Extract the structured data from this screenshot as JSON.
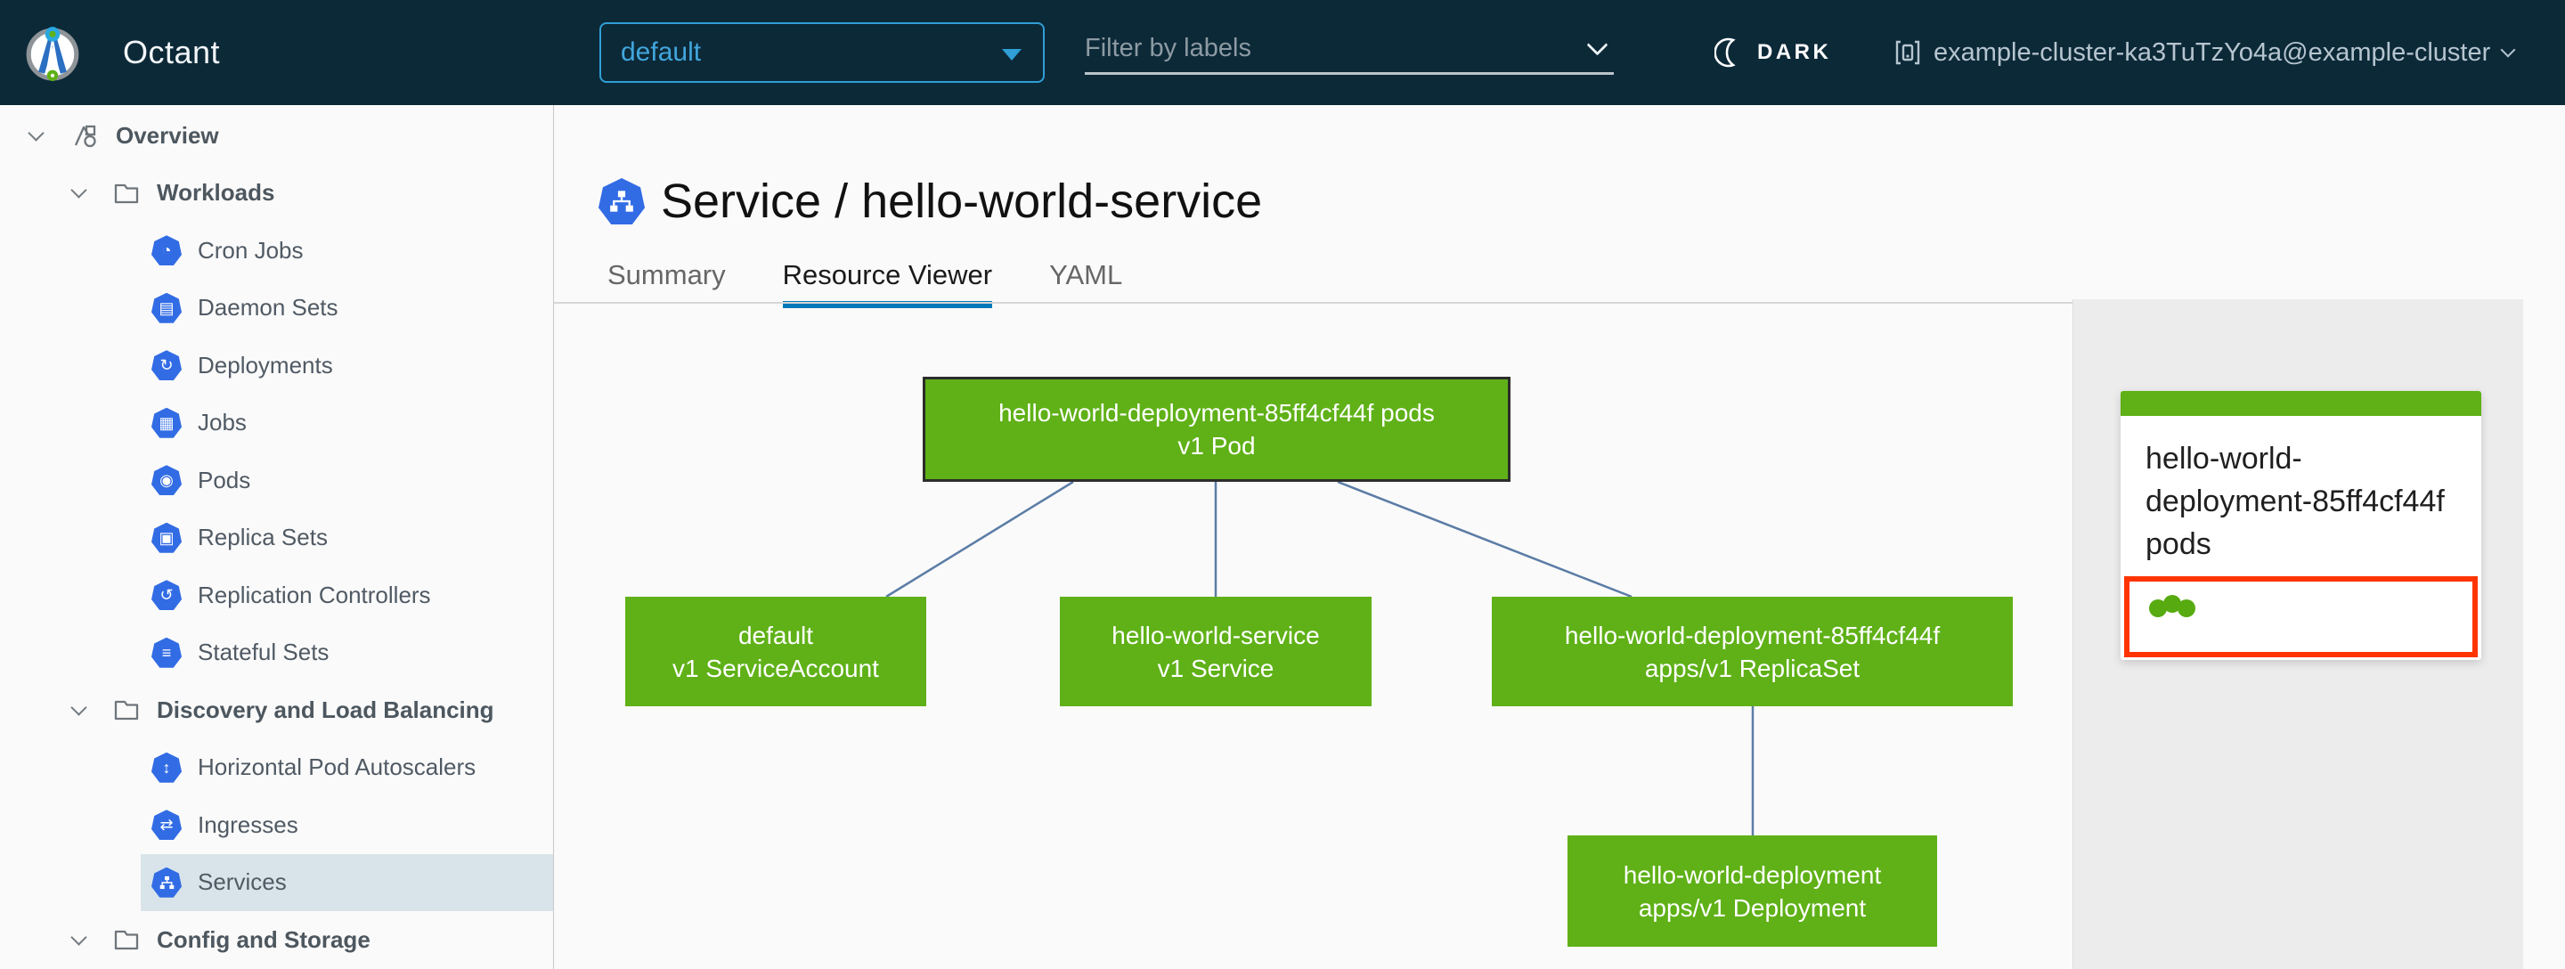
{
  "colors": {
    "header_bg": "#0c2938",
    "accent_blue": "#49afd9",
    "k8s_blue": "#326ce5",
    "node_green": "#5fb117",
    "highlight_red": "#ff3400",
    "tab_underline_blue": "#0079b8",
    "panel_bg": "#ececec",
    "sidebar_selected": "#d9e4ea",
    "edge_blue": "#5b7ca6"
  },
  "header": {
    "app_name": "Octant",
    "namespace_dropdown": {
      "value": "default"
    },
    "label_filter": {
      "placeholder": "Filter by labels"
    },
    "theme_toggle": {
      "label": "DARK"
    },
    "context_selector": {
      "label": "example-cluster-ka3TuTzYo4a@example-cluster"
    }
  },
  "sidebar": {
    "items": [
      {
        "label": "Overview",
        "type": "group",
        "icon": "overview-icon",
        "expanded": true
      },
      {
        "label": "Workloads",
        "type": "group",
        "icon": "folder-icon",
        "expanded": true
      },
      {
        "label": "Cron Jobs",
        "type": "leaf",
        "icon": "cron-jobs-icon",
        "glyph": "◔"
      },
      {
        "label": "Daemon Sets",
        "type": "leaf",
        "icon": "daemon-sets-icon",
        "glyph": "▤"
      },
      {
        "label": "Deployments",
        "type": "leaf",
        "icon": "deployments-icon",
        "glyph": "↻"
      },
      {
        "label": "Jobs",
        "type": "leaf",
        "icon": "jobs-icon",
        "glyph": "▦"
      },
      {
        "label": "Pods",
        "type": "leaf",
        "icon": "pods-icon",
        "glyph": "◉"
      },
      {
        "label": "Replica Sets",
        "type": "leaf",
        "icon": "replica-sets-icon",
        "glyph": "▣"
      },
      {
        "label": "Replication Controllers",
        "type": "leaf",
        "icon": "replication-controllers-icon",
        "glyph": "↺"
      },
      {
        "label": "Stateful Sets",
        "type": "leaf",
        "icon": "stateful-sets-icon",
        "glyph": "≡"
      },
      {
        "label": "Discovery and Load Balancing",
        "type": "group",
        "icon": "folder-icon",
        "expanded": true
      },
      {
        "label": "Horizontal Pod Autoscalers",
        "type": "leaf",
        "icon": "hpa-icon",
        "glyph": "↕"
      },
      {
        "label": "Ingresses",
        "type": "leaf",
        "icon": "ingresses-icon",
        "glyph": "⇄"
      },
      {
        "label": "Services",
        "type": "leaf",
        "icon": "services-icon",
        "selected": true
      },
      {
        "label": "Config and Storage",
        "type": "group",
        "icon": "folder-icon",
        "expanded": true
      }
    ]
  },
  "main": {
    "page_title": "Service / hello-world-service",
    "tabs": [
      {
        "label": "Summary",
        "active": false
      },
      {
        "label": "Resource Viewer",
        "active": true
      },
      {
        "label": "YAML",
        "active": false
      }
    ]
  },
  "graph": {
    "nodes": [
      {
        "name": "hello-world-deployment-85ff4cf44f pods",
        "kind": "v1 Pod",
        "status": "ok",
        "selected": true
      },
      {
        "name": "default",
        "kind": "v1 ServiceAccount",
        "status": "ok"
      },
      {
        "name": "hello-world-service",
        "kind": "v1 Service",
        "status": "ok"
      },
      {
        "name": "hello-world-deployment-85ff4cf44f",
        "kind": "apps/v1 ReplicaSet",
        "status": "ok"
      },
      {
        "name": "hello-world-deployment",
        "kind": "apps/v1 Deployment",
        "status": "ok"
      }
    ],
    "edges": [
      {
        "from": "pod",
        "to": "serviceaccount"
      },
      {
        "from": "pod",
        "to": "service"
      },
      {
        "from": "pod",
        "to": "replicaset"
      },
      {
        "from": "replicaset",
        "to": "deployment"
      }
    ]
  },
  "panel": {
    "card": {
      "title": "hello-world-deployment-85ff4cf44f pods",
      "pod_status_dots": 3
    }
  }
}
